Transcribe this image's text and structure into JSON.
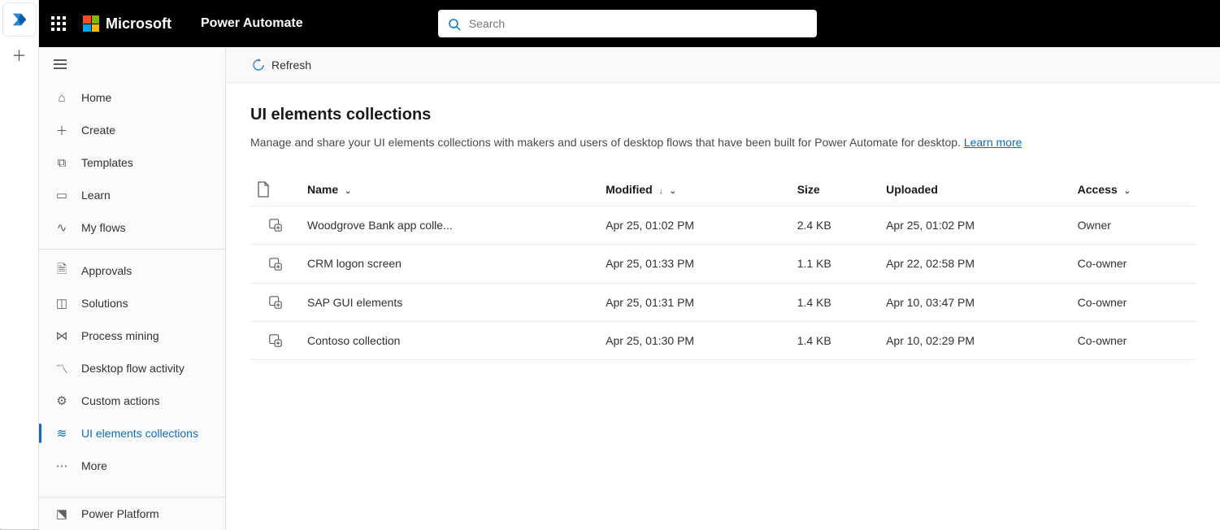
{
  "header": {
    "brand": "Microsoft",
    "app_name": "Power Automate",
    "search_placeholder": "Search"
  },
  "sidebar": {
    "items": [
      {
        "label": "Home",
        "glyph": "⌂"
      },
      {
        "label": "Create",
        "glyph": "＋"
      },
      {
        "label": "Templates",
        "glyph": "⧉"
      },
      {
        "label": "Learn",
        "glyph": "▭"
      },
      {
        "label": "My flows",
        "glyph": "∿"
      }
    ],
    "items2": [
      {
        "label": "Approvals",
        "glyph": "🗎"
      },
      {
        "label": "Solutions",
        "glyph": "◫"
      },
      {
        "label": "Process mining",
        "glyph": "⋈"
      },
      {
        "label": "Desktop flow activity",
        "glyph": "〽"
      },
      {
        "label": "Custom actions",
        "glyph": "⚙"
      },
      {
        "label": "UI elements collections",
        "glyph": "≋",
        "active": true
      },
      {
        "label": "More",
        "glyph": "⋯"
      }
    ],
    "footer": {
      "label": "Power Platform",
      "glyph": "⬔"
    }
  },
  "commandbar": {
    "refresh": "Refresh"
  },
  "page": {
    "title": "UI elements collections",
    "description": "Manage and share your UI elements collections with makers and users of desktop flows that have been built for Power Automate for desktop. ",
    "learn_more": "Learn more"
  },
  "table": {
    "columns": {
      "name": "Name",
      "modified": "Modified",
      "size": "Size",
      "uploaded": "Uploaded",
      "access": "Access"
    },
    "rows": [
      {
        "name": "Woodgrove Bank app colle...",
        "modified": "Apr 25, 01:02 PM",
        "size": "2.4 KB",
        "uploaded": "Apr 25, 01:02 PM",
        "access": "Owner"
      },
      {
        "name": "CRM logon screen",
        "modified": "Apr 25, 01:33 PM",
        "size": "1.1 KB",
        "uploaded": "Apr 22, 02:58 PM",
        "access": "Co-owner"
      },
      {
        "name": "SAP GUI elements",
        "modified": "Apr 25, 01:31 PM",
        "size": "1.4 KB",
        "uploaded": "Apr 10, 03:47 PM",
        "access": "Co-owner"
      },
      {
        "name": "Contoso collection",
        "modified": "Apr 25, 01:30 PM",
        "size": "1.4 KB",
        "uploaded": "Apr 10, 02:29 PM",
        "access": "Co-owner"
      }
    ]
  }
}
